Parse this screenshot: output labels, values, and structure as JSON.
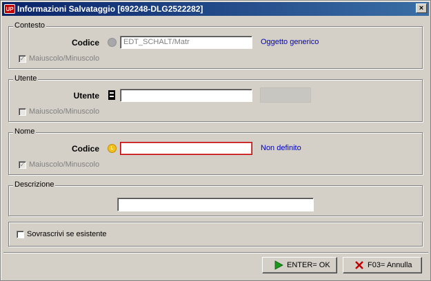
{
  "window": {
    "app_badge": "UP",
    "title": "Informazioni Salvataggio [692248-DLG2522282]",
    "close_glyph": "×"
  },
  "groups": {
    "contesto": {
      "legend": "Contesto",
      "field_label": "Codice",
      "status_icon": "grey-circle-icon",
      "value": "EDT_SCHALT/Matr",
      "hint": "Oggetto generico",
      "case_checkbox_label": "Maiuscolo/Minuscolo",
      "case_checked": true,
      "case_enabled": false
    },
    "utente": {
      "legend": "Utente",
      "field_label": "Utente",
      "status_icon": "lookup-icon",
      "value": "",
      "case_checkbox_label": "Maiuscolo/Minuscolo",
      "case_checked": false,
      "case_enabled": false
    },
    "nome": {
      "legend": "Nome",
      "field_label": "Codice",
      "status_icon": "warning-circle-icon",
      "value": "",
      "hint": "Non definito",
      "case_checkbox_label": "Maiuscolo/Minuscolo",
      "case_checked": true,
      "case_enabled": false
    },
    "descrizione": {
      "legend": "Descrizione",
      "value": ""
    },
    "overwrite": {
      "label": "Sovrascrivi se esistente",
      "checked": false
    }
  },
  "buttons": {
    "ok_label": "ENTER= OK",
    "cancel_label": "F03= Annulla"
  },
  "colors": {
    "title_bar": "#0a246a",
    "hint_text": "#0000c0",
    "error_border": "#c00000",
    "ok_icon": "#1a9a1a",
    "cancel_icon": "#c00000",
    "warning_dot": "#f0c020"
  }
}
